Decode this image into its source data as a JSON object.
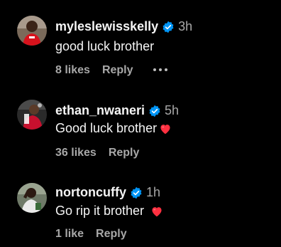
{
  "comments": [
    {
      "username": "myleslewisskelly",
      "time": "3h",
      "text": "good luck brother",
      "heart": false,
      "likes": "8 likes",
      "reply": "Reply",
      "show_more": true
    },
    {
      "username": "ethan_nwaneri",
      "time": "5h",
      "text": "Good luck brother",
      "heart": true,
      "likes": "36 likes",
      "reply": "Reply",
      "show_more": false
    },
    {
      "username": "nortoncuffy",
      "time": "1h",
      "text": "Go rip it brother",
      "heart": true,
      "likes": "1 like",
      "reply": "Reply",
      "show_more": false
    }
  ],
  "colors": {
    "background": "#000000",
    "text": "#f5f5f5",
    "muted": "#a8a8a8",
    "verified": "#0095f6",
    "heart": "#ff3040"
  },
  "icons": [
    "verified-badge-icon",
    "heart-emoji-icon",
    "more-options-icon"
  ]
}
